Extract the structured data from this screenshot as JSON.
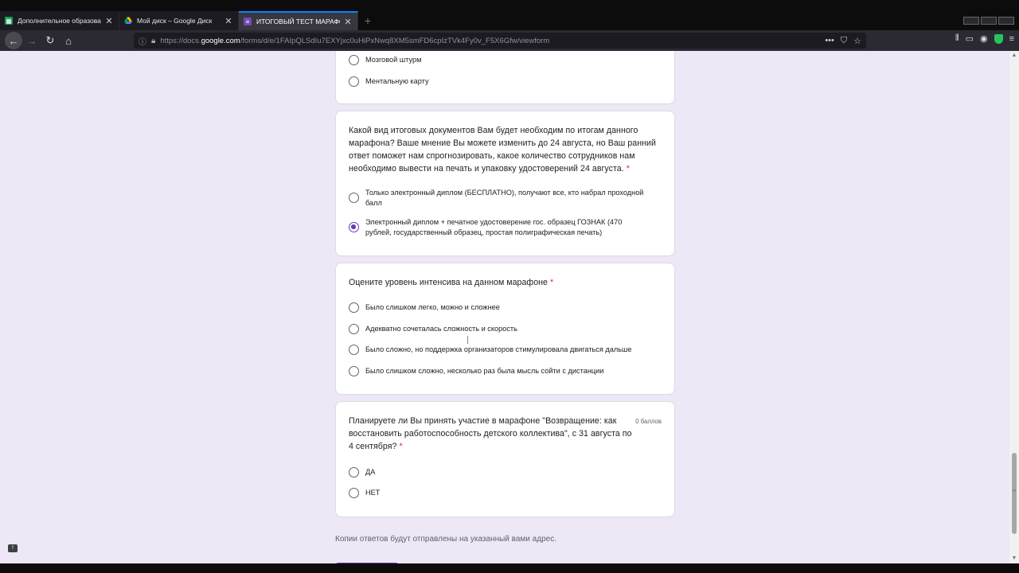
{
  "browser": {
    "tabs": [
      {
        "title": "Дополнительное образовани",
        "icon": "sheets-icon",
        "active": false
      },
      {
        "title": "Мой диск – Google Диск",
        "icon": "drive-icon",
        "active": false
      },
      {
        "title": "ИТОГОВЫЙ ТЕСТ МАРАФОН",
        "icon": "forms-icon",
        "active": true
      }
    ],
    "new_tab": "+",
    "url_prefix": "https://docs.",
    "url_host": "google.com",
    "url_path": "/forms/d/e/1FAIpQLSdIu7EXYjxc0uHiPxNwq8XM5smFD6cpIzTVk4Fy0v_F5X6Gfw/viewform",
    "url_more": "•••"
  },
  "form": {
    "prev_options": [
      "Мозговой штурм",
      "Ментальную карту"
    ],
    "q_docs": {
      "text": "Какой вид итоговых документов Вам будет необходим по итогам данного марафона? Ваше мнение Вы можете изменить до 24 августа, но Ваш ранний ответ поможет нам спрогнозировать, какое количество сотрудников нам необходимо вывести на печать и упаковку удостоверений 24 августа.",
      "required": "*",
      "options": [
        {
          "label": "Только электронный диплом (БЕСПЛАТНО), получают все, кто набрал проходной балл",
          "checked": false
        },
        {
          "label": "Электронный диплом + печатное удостоверение гос. образец ГОЗНАК (470 рублей, государственный образец, простая полиграфическая печать)",
          "checked": true
        }
      ]
    },
    "q_intensity": {
      "text": "Оцените уровень интенсива на данном марафоне",
      "required": "*",
      "options": [
        "Было слишком легко, можно и сложнее",
        "Адекватно сочеталась сложность и скорость",
        "Было сложно, но поддержка организаторов стимулировала двигаться дальше",
        "Было слишком сложно, несколько раз была мысль сойти с дистанции"
      ]
    },
    "q_next": {
      "text": "Планируете ли Вы принять участие в марафоне \"Возвращение: как восстановить работоспособность детского коллектива\", с 31 августа по 4 сентября?",
      "required": "*",
      "points": "0 баллов",
      "options": [
        "ДА",
        "НЕТ"
      ]
    },
    "footer_note": "Копии ответов будут отправлены на указанный вами адрес.",
    "accent_color": "#673ab7"
  }
}
